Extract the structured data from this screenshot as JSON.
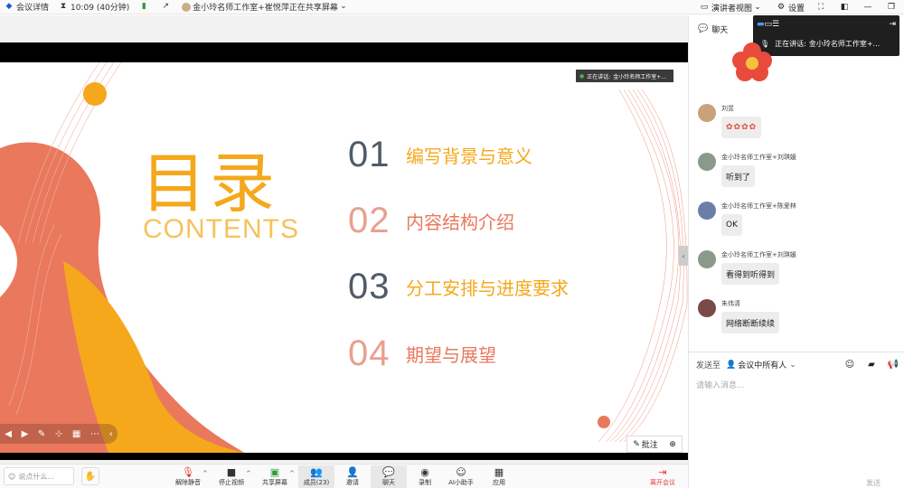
{
  "topbar": {
    "meeting_info": "会议详情",
    "time": "10:09 (40分钟)",
    "sharing_status": "金小玲名师工作室+崔悦萍正在共享屏幕",
    "presenter_view": "演讲者视图",
    "settings": "设置"
  },
  "stage": {
    "speaking_label": "正在讲话:",
    "speaking_name": "金小玲名师工作室+..."
  },
  "slide": {
    "title_cn": "目录",
    "title_en": "CONTENTS",
    "items": [
      {
        "num": "01",
        "text": "编写背景与意义"
      },
      {
        "num": "02",
        "text": "内容结构介绍"
      },
      {
        "num": "03",
        "text": "分工安排与进度要求"
      },
      {
        "num": "04",
        "text": "期望与展望"
      }
    ],
    "annotate_label": "批注"
  },
  "toolbar": {
    "say_placeholder": "说点什么...",
    "unmute": "解除静音",
    "stop_video": "停止视频",
    "share_screen": "共享屏幕",
    "members": "成员(23)",
    "invite": "邀请",
    "chat": "聊天",
    "record": "录制",
    "ai_assistant": "AI小助手",
    "apps": "应用",
    "leave": "离开会议"
  },
  "chat": {
    "title": "聊天",
    "popup_label": "正在讲话:",
    "popup_name": "金小玲名师工作室+...",
    "messages": [
      {
        "name": "刘昱",
        "text": "✿✿✿✿",
        "avatar_color": "#c9a27a"
      },
      {
        "name": "金小玲名师工作室+刘琪媛",
        "text": "听到了",
        "avatar_color": "#8a9a8a"
      },
      {
        "name": "金小玲名师工作室+陈爱林",
        "text": "OK",
        "avatar_color": "#6a7fa8"
      },
      {
        "name": "金小玲名师工作室+刘琪媛",
        "text": "看得到听得到",
        "avatar_color": "#8a9a8a"
      },
      {
        "name": "朱伟清",
        "text": "网络断断续续",
        "avatar_color": "#7a4a48"
      }
    ],
    "send_to_label": "发送至",
    "send_to_target": "会议中所有人",
    "input_placeholder": "请输入消息...",
    "send_label": "发送"
  },
  "colors": {
    "orange": "#f5a81c",
    "coral": "#e9785d",
    "grey_num": "#4f5b68",
    "pink_num": "#e8a08f",
    "leave_red": "#e53935"
  }
}
